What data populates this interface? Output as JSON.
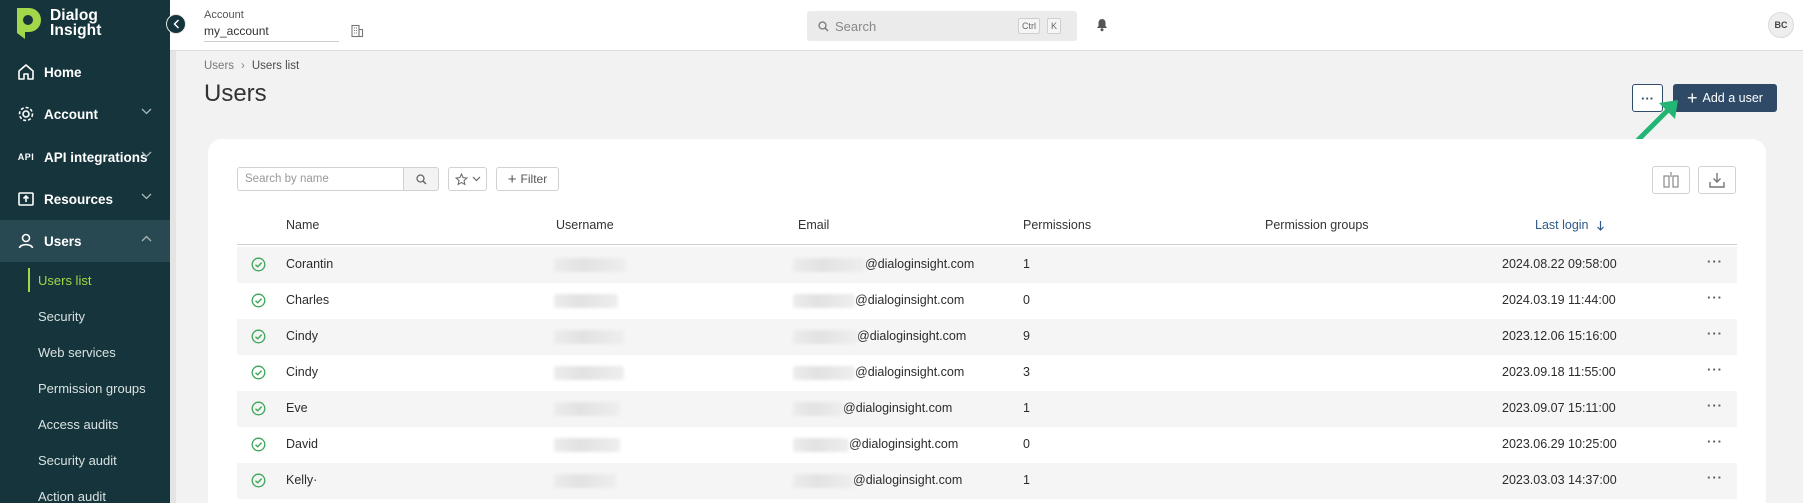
{
  "brand": {
    "line1": "Dialog",
    "line2": "Insight",
    "accent": "#a4d64a",
    "sidebar_bg": "#16343b"
  },
  "sidebar": {
    "items": [
      {
        "label": "Home",
        "icon": "home-icon"
      },
      {
        "label": "Account",
        "icon": "gear-icon"
      },
      {
        "label": "API integrations",
        "icon": "api-icon",
        "icon_text": "API"
      },
      {
        "label": "Resources",
        "icon": "upload-box-icon"
      },
      {
        "label": "Users",
        "icon": "user-icon"
      }
    ],
    "sub_items": [
      "Users list",
      "Security",
      "Web services",
      "Permission groups",
      "Access audits",
      "Security audit",
      "Action audit"
    ]
  },
  "topbar": {
    "account_label": "Account",
    "account_value": "my_account",
    "search_placeholder": "Search",
    "shortcut_ctrl": "Ctrl",
    "shortcut_key": "K",
    "avatar_initials": "BC"
  },
  "breadcrumb": {
    "root": "Users",
    "current": "Users list"
  },
  "page": {
    "title": "Users",
    "more_label": "···",
    "add_label": "Add a user"
  },
  "toolbar": {
    "search_placeholder": "Search by name",
    "filter_label": "Filter"
  },
  "table": {
    "columns": [
      "Name",
      "Username",
      "Email",
      "Permissions",
      "Permission groups",
      "Last login"
    ],
    "sorted_column": "Last login",
    "sort_direction": "desc",
    "rows": [
      {
        "name": "Corantin",
        "email_domain": "@dialoginsight.com",
        "permissions": "1",
        "groups": "",
        "last_login": "2024.08.22 09:58:00"
      },
      {
        "name": "Charles",
        "email_domain": "@dialoginsight.com",
        "permissions": "0",
        "groups": "",
        "last_login": "2024.03.19 11:44:00"
      },
      {
        "name": "Cindy",
        "email_domain": "@dialoginsight.com",
        "permissions": "9",
        "groups": "",
        "last_login": "2023.12.06 15:16:00"
      },
      {
        "name": "Cindy",
        "email_domain": "@dialoginsight.com",
        "permissions": "3",
        "groups": "",
        "last_login": "2023.09.18 11:55:00"
      },
      {
        "name": "Eve",
        "email_domain": "@dialoginsight.com",
        "permissions": "1",
        "groups": "",
        "last_login": "2023.09.07 15:11:00"
      },
      {
        "name": "David",
        "email_domain": "@dialoginsight.com",
        "permissions": "0",
        "groups": "",
        "last_login": "2023.06.29 10:25:00"
      },
      {
        "name": "Kelly·",
        "email_domain": "@dialoginsight.com",
        "permissions": "1",
        "groups": "",
        "last_login": "2023.03.03 14:37:00"
      }
    ]
  },
  "colors": {
    "primary_button": "#2e4a66",
    "sort_link": "#2f5a8a",
    "check_green": "#3aa657",
    "annotation_arrow": "#22b573"
  }
}
